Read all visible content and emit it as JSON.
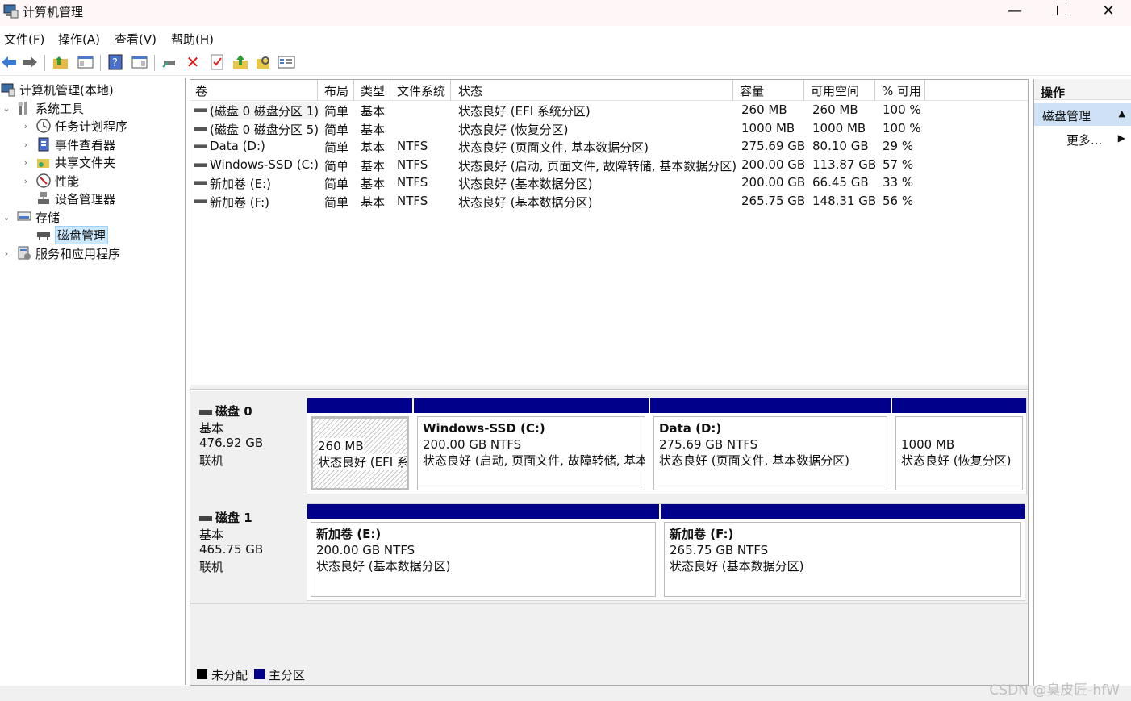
{
  "window": {
    "title": "计算机管理"
  },
  "menu": [
    "文件(F)",
    "操作(A)",
    "查看(V)",
    "帮助(H)"
  ],
  "tree": [
    {
      "label": "计算机管理(本地)",
      "icon": "computer-icon"
    },
    {
      "label": "系统工具",
      "icon": "tools-icon"
    },
    {
      "label": "任务计划程序",
      "icon": "clock-icon"
    },
    {
      "label": "事件查看器",
      "icon": "event-viewer-icon"
    },
    {
      "label": "共享文件夹",
      "icon": "shared-folder-icon"
    },
    {
      "label": "性能",
      "icon": "performance-icon"
    },
    {
      "label": "设备管理器",
      "icon": "device-manager-icon"
    },
    {
      "label": "存储",
      "icon": "storage-icon"
    },
    {
      "label": "磁盘管理",
      "icon": "disk-management-icon"
    },
    {
      "label": "服务和应用程序",
      "icon": "services-icon"
    }
  ],
  "table": {
    "headers": [
      "卷",
      "布局",
      "类型",
      "文件系统",
      "状态",
      "容量",
      "可用空间",
      "% 可用"
    ],
    "rows": [
      [
        "(磁盘 0 磁盘分区 1)",
        "简单",
        "基本",
        "",
        "状态良好 (EFI 系统分区)",
        "260 MB",
        "260 MB",
        "100 %"
      ],
      [
        "(磁盘 0 磁盘分区 5)",
        "简单",
        "基本",
        "",
        "状态良好 (恢复分区)",
        "1000 MB",
        "1000 MB",
        "100 %"
      ],
      [
        "Data (D:)",
        "简单",
        "基本",
        "NTFS",
        "状态良好 (页面文件, 基本数据分区)",
        "275.69 GB",
        "80.10 GB",
        "29 %"
      ],
      [
        "Windows-SSD (C:)",
        "简单",
        "基本",
        "NTFS",
        "状态良好 (启动, 页面文件, 故障转储, 基本数据分区)",
        "200.00 GB",
        "113.87 GB",
        "57 %"
      ],
      [
        "新加卷 (E:)",
        "简单",
        "基本",
        "NTFS",
        "状态良好 (基本数据分区)",
        "200.00 GB",
        "66.45 GB",
        "33 %"
      ],
      [
        "新加卷 (F:)",
        "简单",
        "基本",
        "NTFS",
        "状态良好 (基本数据分区)",
        "265.75 GB",
        "148.31 GB",
        "56 %"
      ]
    ]
  },
  "disks": [
    {
      "name": "磁盘 0",
      "type": "基本",
      "size": "476.92 GB",
      "status": "联机",
      "partitions": [
        {
          "title": "",
          "line1": "260 MB",
          "line2": "状态良好 (EFI 系统分区)"
        },
        {
          "title": "Windows-SSD  (C:)",
          "line1": "200.00 GB NTFS",
          "line2": "状态良好 (启动, 页面文件, 故障转储, 基本数据分区)"
        },
        {
          "title": "Data  (D:)",
          "line1": "275.69 GB NTFS",
          "line2": "状态良好 (页面文件, 基本数据分区)"
        },
        {
          "title": "",
          "line1": "1000 MB",
          "line2": "状态良好 (恢复分区)"
        }
      ]
    },
    {
      "name": "磁盘 1",
      "type": "基本",
      "size": "465.75 GB",
      "status": "联机",
      "partitions": [
        {
          "title": "新加卷  (E:)",
          "line1": "200.00 GB NTFS",
          "line2": "状态良好 (基本数据分区)"
        },
        {
          "title": "新加卷  (F:)",
          "line1": "265.75 GB NTFS",
          "line2": "状态良好 (基本数据分区)"
        }
      ]
    }
  ],
  "legend": [
    {
      "label": "未分配",
      "color": "#000000"
    },
    {
      "label": "主分区",
      "color": "#00008b"
    }
  ],
  "actions": {
    "header": "操作",
    "item": "磁盘管理",
    "more": "更多..."
  },
  "watermark": "CSDN @臭皮匠-hfW",
  "colors": {
    "partition_bar": "#00008b",
    "selection": "#cce8ff"
  }
}
